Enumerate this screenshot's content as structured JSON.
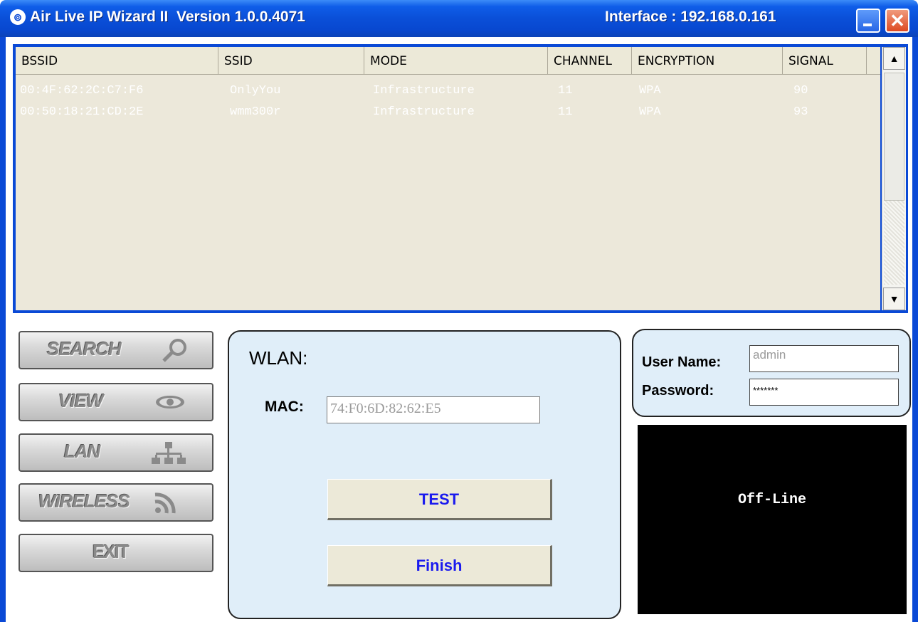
{
  "titlebar": {
    "title": "Air Live IP Wizard II  Version 1.0.0.4071",
    "interface": "Interface : 192.168.0.161",
    "icon": "wifi-antenna-icon",
    "minimize_icon": "minimize-icon",
    "close_icon": "close-icon",
    "close_glyph": "✕"
  },
  "network_list": {
    "columns": [
      "BSSID",
      "SSID",
      "MODE",
      "CHANNEL",
      "ENCRYPTION",
      "SIGNAL"
    ],
    "rows": [
      [
        "00:4F:62:2C:C7:F6",
        "OnlyYou",
        "Infrastructure",
        "11",
        "WPA",
        "90"
      ],
      [
        "00:50:18:21:CD:2E",
        "wmm300r",
        "Infrastructure",
        "11",
        "WPA",
        "93"
      ]
    ],
    "scroll_up": "▲",
    "scroll_down": "▼"
  },
  "nav": {
    "search": "SEARCH",
    "view": "VIEW",
    "lan": "LAN",
    "wireless": "WIRELESS",
    "exit": "EXIT"
  },
  "wlan": {
    "title": "WLAN:",
    "mac_label": "MAC:",
    "mac_value": "74:F0:6D:82:62:E5",
    "test_label": "TEST",
    "finish_label": "Finish"
  },
  "login": {
    "user_label": "User Name:",
    "user_value": "admin",
    "password_label": "Password:",
    "password_value": "*******"
  },
  "video": {
    "status": "Off-Line"
  },
  "colors": {
    "titlebar": "#0a49d6",
    "list_bg": "#ece8da",
    "panel_bg": "#e0eef9",
    "button_text": "#1a1aee"
  }
}
